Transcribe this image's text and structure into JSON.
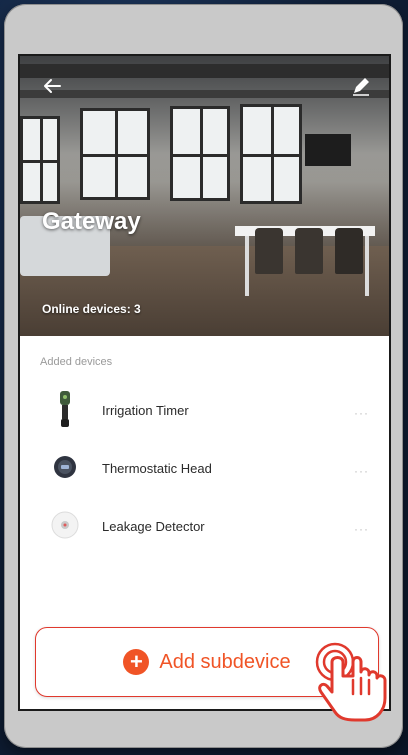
{
  "header": {
    "title": "Gateway",
    "online_devices": "Online devices: 3"
  },
  "devices": {
    "section_label": "Added devices",
    "items": [
      {
        "label": "Irrigation Timer",
        "icon": "irrigation-timer-icon",
        "more": "···"
      },
      {
        "label": "Thermostatic Head",
        "icon": "thermostatic-head-icon",
        "more": "···"
      },
      {
        "label": "Leakage Detector",
        "icon": "leakage-detector-icon",
        "more": "···"
      }
    ]
  },
  "actions": {
    "add_subdevice_label": "Add subdevice",
    "plus_symbol": "+"
  },
  "colors": {
    "accent": "#f05426",
    "button_border": "#e0392d",
    "background": "#13243f"
  }
}
